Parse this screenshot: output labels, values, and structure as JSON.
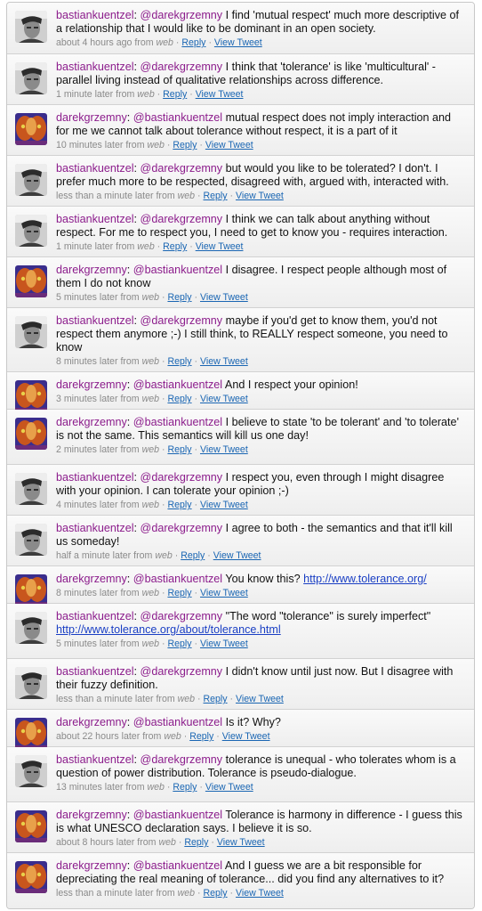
{
  "labels": {
    "reply": "Reply",
    "view_tweet": "View Tweet",
    "from": "from",
    "source": "web",
    "separator": "·",
    "colon": ":",
    "space": " "
  },
  "tweets": [
    {
      "user": "bastiankuentzel",
      "avatar": "man",
      "mention": "@darekgrzemny",
      "text": " I find 'mutual respect' much more descriptive of a relationship that I would like to be dominant in an open society.",
      "time": "about 4 hours ago"
    },
    {
      "user": "bastiankuentzel",
      "avatar": "man",
      "mention": "@darekgrzemny",
      "text": " I think that 'tolerance' is like 'multicultural' - parallel living instead of qualitative relationships across difference.",
      "time": "1 minute later"
    },
    {
      "user": "darekgrzemny",
      "avatar": "mask",
      "mention": "@bastiankuentzel",
      "text": " mutual respect does not imply interaction and for me we cannot talk about tolerance without respect, it is a part of it",
      "time": "10 minutes later"
    },
    {
      "user": "bastiankuentzel",
      "avatar": "man",
      "mention": "@darekgrzemny",
      "text": " but would you like to be tolerated? I don't. I prefer much more to be respected, disagreed with, argued with, interacted with.",
      "time": "less than a minute later"
    },
    {
      "user": "bastiankuentzel",
      "avatar": "man",
      "mention": "@darekgrzemny",
      "text": " I think we can talk about anything without respect. For me to respect you, I need to get to know you - requires interaction.",
      "time": "1 minute later"
    },
    {
      "user": "darekgrzemny",
      "avatar": "mask",
      "mention": "@bastiankuentzel",
      "text": " I disagree. I respect people although most of them I do not know",
      "time": "5 minutes later"
    },
    {
      "user": "bastiankuentzel",
      "avatar": "man",
      "mention": "@darekgrzemny",
      "text": " maybe if you'd get to know them, you'd not respect them anymore ;-) I still think, to REALLY respect someone, you need to know",
      "time": "8 minutes later"
    },
    {
      "user": "darekgrzemny",
      "avatar": "mask",
      "mention": "@bastiankuentzel",
      "text": " And I respect your opinion!",
      "time": "3 minutes later"
    },
    {
      "user": "darekgrzemny",
      "avatar": "mask",
      "mention": "@bastiankuentzel",
      "text": " I believe to state 'to be tolerant' and 'to tolerate' is not the same. This semantics will kill us one day!",
      "time": "2 minutes later"
    },
    {
      "user": "bastiankuentzel",
      "avatar": "man",
      "mention": "@darekgrzemny",
      "text": " I respect you, even through I might disagree with your opinion. I can tolerate your opinion ;-)",
      "time": "4 minutes later"
    },
    {
      "user": "bastiankuentzel",
      "avatar": "man",
      "mention": "@darekgrzemny",
      "text": " I agree to both - the semantics and that it'll kill us someday!",
      "time": "half a minute later"
    },
    {
      "user": "darekgrzemny",
      "avatar": "mask",
      "mention": "@bastiankuentzel",
      "text": " You know this? ",
      "link": "http://www.tolerance.org/",
      "time": "8 minutes later"
    },
    {
      "user": "bastiankuentzel",
      "avatar": "man",
      "mention": "@darekgrzemny",
      "text": " \"The word \"tolerance\" is surely imperfect\" ",
      "link": "http://www.tolerance.org/about/tolerance.html",
      "time": "5 minutes later"
    },
    {
      "user": "bastiankuentzel",
      "avatar": "man",
      "mention": "@darekgrzemny",
      "text": " I didn't know until just now. But I disagree with their fuzzy definition.",
      "time": "less than a minute later"
    },
    {
      "user": "darekgrzemny",
      "avatar": "mask",
      "mention": "@bastiankuentzel",
      "text": " Is it? Why?",
      "time": "about 22 hours later"
    },
    {
      "user": "bastiankuentzel",
      "avatar": "man",
      "mention": "@darekgrzemny",
      "text": " tolerance is unequal - who tolerates whom is a question of power distribution. Tolerance is pseudo-dialogue.",
      "time": "13 minutes later"
    },
    {
      "user": "darekgrzemny",
      "avatar": "mask",
      "mention": "@bastiankuentzel",
      "text": " Tolerance is harmony in difference - I guess this is what UNESCO declaration says. I believe it is so.",
      "time": "about 8 hours later"
    },
    {
      "user": "darekgrzemny",
      "avatar": "mask",
      "mention": "@bastiankuentzel",
      "text": " And I guess we are a bit responsible for depreciating the real meaning of tolerance... did you find any alternatives to it?",
      "time": "less than a minute later"
    }
  ]
}
